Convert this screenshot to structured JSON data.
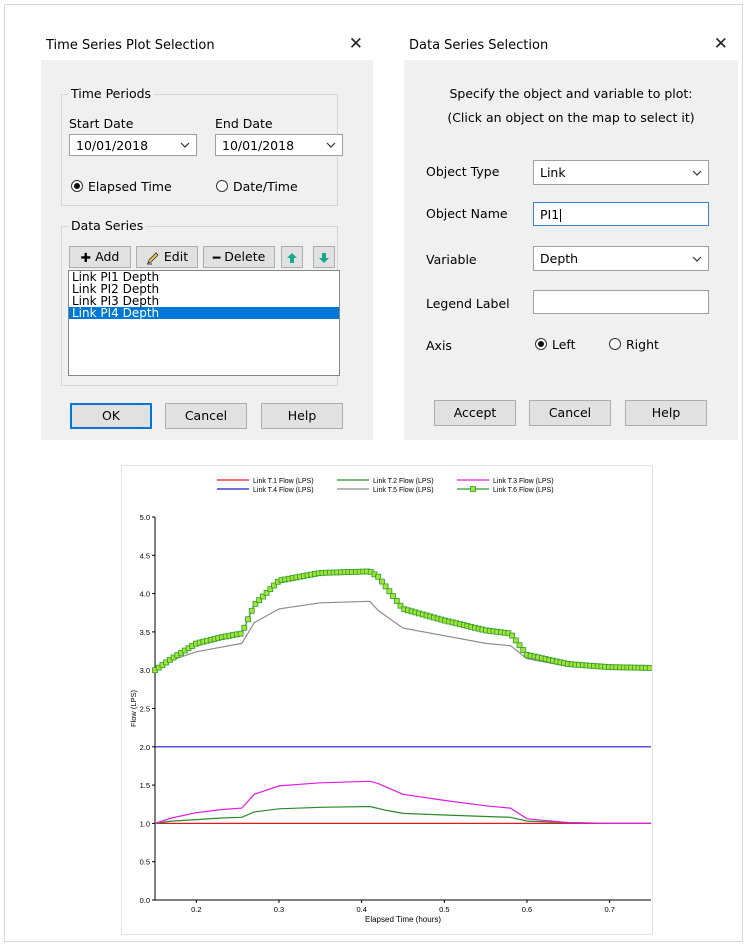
{
  "ts_dialog": {
    "title": "Time Series Plot Selection",
    "close_glyph": "✕",
    "time_periods": {
      "group_label": "Time Periods",
      "start_label": "Start Date",
      "start_value": "10/01/2018",
      "end_label": "End Date",
      "end_value": "10/01/2018",
      "elapsed_label": "Elapsed Time",
      "datetime_label": "Date/Time",
      "selected_mode": "elapsed"
    },
    "data_series": {
      "group_label": "Data Series",
      "add_label": "Add",
      "edit_label": "Edit",
      "delete_label": "Delete",
      "items": [
        "Link PI1 Depth",
        "Link PI2 Depth",
        "Link PI3 Depth",
        "Link PI4 Depth"
      ],
      "selected_index": 3
    },
    "ok_label": "OK",
    "cancel_label": "Cancel",
    "help_label": "Help"
  },
  "ds_dialog": {
    "title": "Data Series Selection",
    "close_glyph": "✕",
    "prompt_line1": "Specify the object and variable to plot:",
    "prompt_line2": "(Click an object on the map to select it)",
    "object_type_label": "Object Type",
    "object_type_value": "Link",
    "object_name_label": "Object Name",
    "object_name_value": "PI1",
    "variable_label": "Variable",
    "variable_value": "Depth",
    "legend_label_label": "Legend Label",
    "legend_label_value": "",
    "axis_label": "Axis",
    "left_label": "Left",
    "right_label": "Right",
    "selected_axis": "left",
    "accept_label": "Accept",
    "cancel_label": "Cancel",
    "help_label": "Help"
  },
  "chart_data": {
    "type": "line",
    "title": "",
    "xlabel": "Elapsed Time (hours)",
    "ylabel": "Flow (LPS)",
    "xlim": [
      0.15,
      0.75
    ],
    "ylim": [
      0.0,
      5.0
    ],
    "xticks": [
      0.2,
      0.3,
      0.4,
      0.5,
      0.6,
      0.7
    ],
    "yticks": [
      0.0,
      0.5,
      1.0,
      1.5,
      2.0,
      2.5,
      3.0,
      3.5,
      4.0,
      4.5,
      5.0
    ],
    "grid": false,
    "legend_position": "top",
    "series": [
      {
        "name": "Link T.1 Flow (LPS)",
        "color": "#e11b1b",
        "x": [
          0.15,
          0.75
        ],
        "y": [
          1.0,
          1.0
        ]
      },
      {
        "name": "Link T.2 Flow (LPS)",
        "color": "#2a8a2a",
        "x": [
          0.15,
          0.17,
          0.2,
          0.23,
          0.255,
          0.27,
          0.3,
          0.35,
          0.41,
          0.43,
          0.45,
          0.5,
          0.55,
          0.58,
          0.6,
          0.65,
          0.7,
          0.75
        ],
        "y": [
          1.0,
          1.03,
          1.05,
          1.07,
          1.08,
          1.15,
          1.19,
          1.21,
          1.22,
          1.17,
          1.13,
          1.11,
          1.09,
          1.08,
          1.03,
          1.01,
          1.0,
          1.0
        ]
      },
      {
        "name": "Link T.3 Flow (LPS)",
        "color": "#e11be1",
        "x": [
          0.15,
          0.17,
          0.2,
          0.23,
          0.255,
          0.27,
          0.3,
          0.35,
          0.41,
          0.42,
          0.45,
          0.5,
          0.55,
          0.58,
          0.6,
          0.65,
          0.7,
          0.75
        ],
        "y": [
          1.0,
          1.07,
          1.14,
          1.18,
          1.2,
          1.38,
          1.49,
          1.53,
          1.55,
          1.52,
          1.38,
          1.3,
          1.23,
          1.2,
          1.06,
          1.01,
          1.0,
          1.0
        ]
      },
      {
        "name": "Link T.4 Flow (LPS)",
        "color": "#1b1bc8",
        "x": [
          0.15,
          0.75
        ],
        "y": [
          2.0,
          2.0
        ]
      },
      {
        "name": "Link T.5 Flow (LPS)",
        "color": "#8c8c8c",
        "x": [
          0.15,
          0.17,
          0.2,
          0.23,
          0.255,
          0.27,
          0.3,
          0.35,
          0.41,
          0.42,
          0.45,
          0.5,
          0.55,
          0.58,
          0.6,
          0.65,
          0.7,
          0.75
        ],
        "y": [
          3.0,
          3.13,
          3.24,
          3.3,
          3.35,
          3.62,
          3.8,
          3.88,
          3.9,
          3.78,
          3.55,
          3.45,
          3.35,
          3.32,
          3.15,
          3.05,
          3.03,
          3.02
        ]
      },
      {
        "name": "Link T.6 Flow (LPS)",
        "color": "#2a9d2a",
        "marker": "square",
        "marker_fill": "#a6e23a",
        "x": [
          0.15,
          0.17,
          0.2,
          0.23,
          0.255,
          0.27,
          0.3,
          0.35,
          0.41,
          0.42,
          0.45,
          0.5,
          0.55,
          0.58,
          0.6,
          0.65,
          0.7,
          0.75
        ],
        "y": [
          3.0,
          3.15,
          3.35,
          3.43,
          3.48,
          3.85,
          4.17,
          4.27,
          4.29,
          4.22,
          3.8,
          3.65,
          3.52,
          3.48,
          3.2,
          3.08,
          3.04,
          3.03
        ]
      }
    ]
  }
}
